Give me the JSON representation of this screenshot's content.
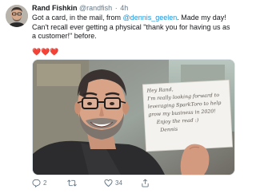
{
  "tweet": {
    "author_name": "Rand Fishkin",
    "author_handle": "@randfish",
    "separator": "·",
    "time": "4h",
    "text_before": "Got a card, in the mail, from ",
    "mention": "@dennis_geelen",
    "text_after": ". Made my day! Can't recall ever getting a physical \"thank you for having us as a customer!\" before.",
    "hearts": "❤️❤️❤️",
    "card_note": [
      "Hey Rand,",
      "I'm really looking forward to",
      "leveraging SparkToro to help",
      "grow my business in 2020!",
      "Enjoy the read :)",
      "Dennis"
    ]
  },
  "actions": {
    "reply_count": "2",
    "retweet_count": "",
    "like_count": "34",
    "icons": [
      "reply-icon",
      "retweet-icon",
      "like-icon",
      "share-icon"
    ]
  },
  "colors": {
    "link": "#1b95e0",
    "secondary_text": "#657786",
    "heart": "#e0245e",
    "border": "#e1e8ed"
  }
}
